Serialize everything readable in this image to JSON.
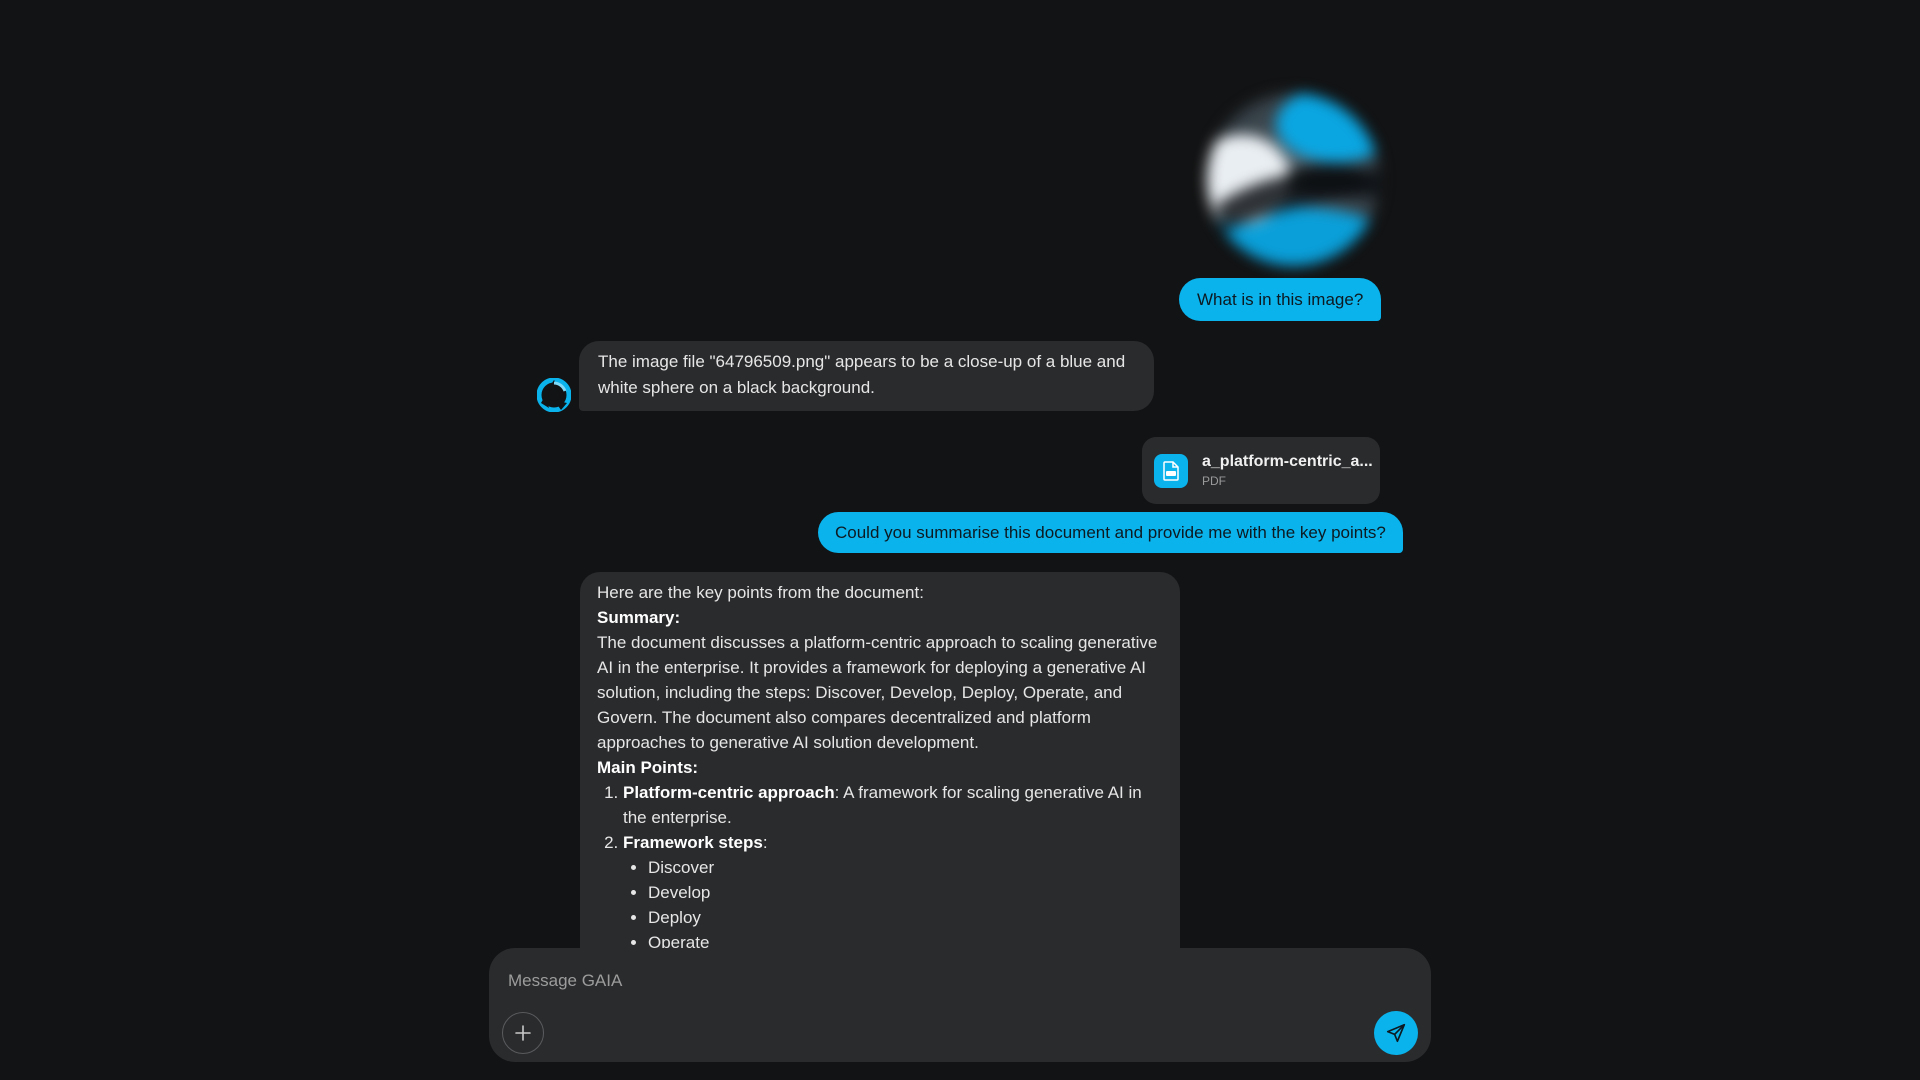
{
  "conversation": {
    "user_message_1": {
      "image_alt": "blurred blue and white sphere",
      "text": "What is in this image?"
    },
    "ai_message_1": {
      "text": "The image file \"64796509.png\" appears to be a close-up of a blue and white sphere on a black background."
    },
    "user_message_2": {
      "attachment": {
        "name": "a_platform-centric_a...",
        "type": "PDF",
        "icon": "pdf-icon"
      },
      "text": "Could you summarise this document and provide me with the key points?"
    },
    "ai_message_2": {
      "intro": "Here are the key points from the document:",
      "summary_heading": "Summary:",
      "summary_text": "The document discusses a platform-centric approach to scaling generative AI in the enterprise. It provides a framework for deploying a generative AI solution, including the steps: Discover, Develop, Deploy, Operate, and Govern. The document also compares decentralized and platform approaches to generative AI solution development.",
      "main_points_heading": "Main Points:",
      "points": [
        {
          "title": "Platform-centric approach",
          "text": ": A framework for scaling generative AI in the enterprise."
        },
        {
          "title": "Framework steps",
          "text": ":"
        }
      ],
      "steps": [
        "Discover",
        "Develop",
        "Deploy",
        "Operate"
      ]
    }
  },
  "composer": {
    "placeholder": "Message GAIA",
    "value": "",
    "add_icon": "plus-icon",
    "send_icon": "send-icon"
  },
  "colors": {
    "background": "#121314",
    "bubble_ai": "#2a2b2d",
    "accent": "#0ab3ec"
  }
}
